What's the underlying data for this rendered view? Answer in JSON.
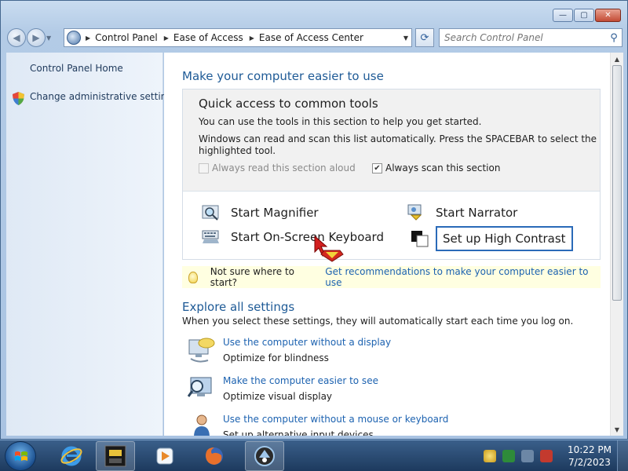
{
  "window": {
    "caption_buttons": [
      {
        "name": "minimize-button",
        "glyph": "—"
      },
      {
        "name": "maximize-button",
        "glyph": "▢"
      },
      {
        "name": "close-button",
        "glyph": "✕"
      }
    ]
  },
  "nav": {
    "breadcrumbs": [
      "Control Panel",
      "Ease of Access",
      "Ease of Access Center"
    ],
    "search_placeholder": "Search Control Panel"
  },
  "leftpane": {
    "home_link": "Control Panel Home",
    "admin_link": "Change administrative settings"
  },
  "main": {
    "heading": "Make your computer easier to use",
    "quick_access": {
      "title": "Quick access to common tools",
      "intro": "You can use the tools in this section to help you get started.",
      "scan_line1": "Windows can read and scan this list automatically.  Press the SPACEBAR to select the",
      "scan_line2": "highlighted tool.",
      "read_aloud_label": "Always read this section aloud",
      "read_aloud_checked": false,
      "scan_label": "Always scan this section",
      "scan_checked": true,
      "tools": {
        "magnifier": "Start Magnifier",
        "narrator": "Start Narrator",
        "keyboard": "Start On-Screen Keyboard",
        "high_contrast": "Set up High Contrast"
      }
    },
    "tip": {
      "text": "Not sure where to start?",
      "link": "Get recommendations to make your computer easier to use"
    },
    "explore": {
      "heading": "Explore all settings",
      "subtitle": "When you select these settings, they will automatically start each time you log on.",
      "items": [
        {
          "link": "Use the computer without a display",
          "desc": "Optimize for blindness"
        },
        {
          "link": "Make the computer easier to see",
          "desc": "Optimize visual display"
        },
        {
          "link": "Use the computer without a mouse or keyboard",
          "desc": "Set up alternative input devices"
        }
      ]
    }
  },
  "taskbar": {
    "time": "10:22 PM",
    "date": "7/2/2023"
  },
  "colors": {
    "link": "#1c62b0",
    "heading": "#1e5a96",
    "taskbar": "#1d3a5e",
    "tip_bg": "#ffffe1"
  }
}
